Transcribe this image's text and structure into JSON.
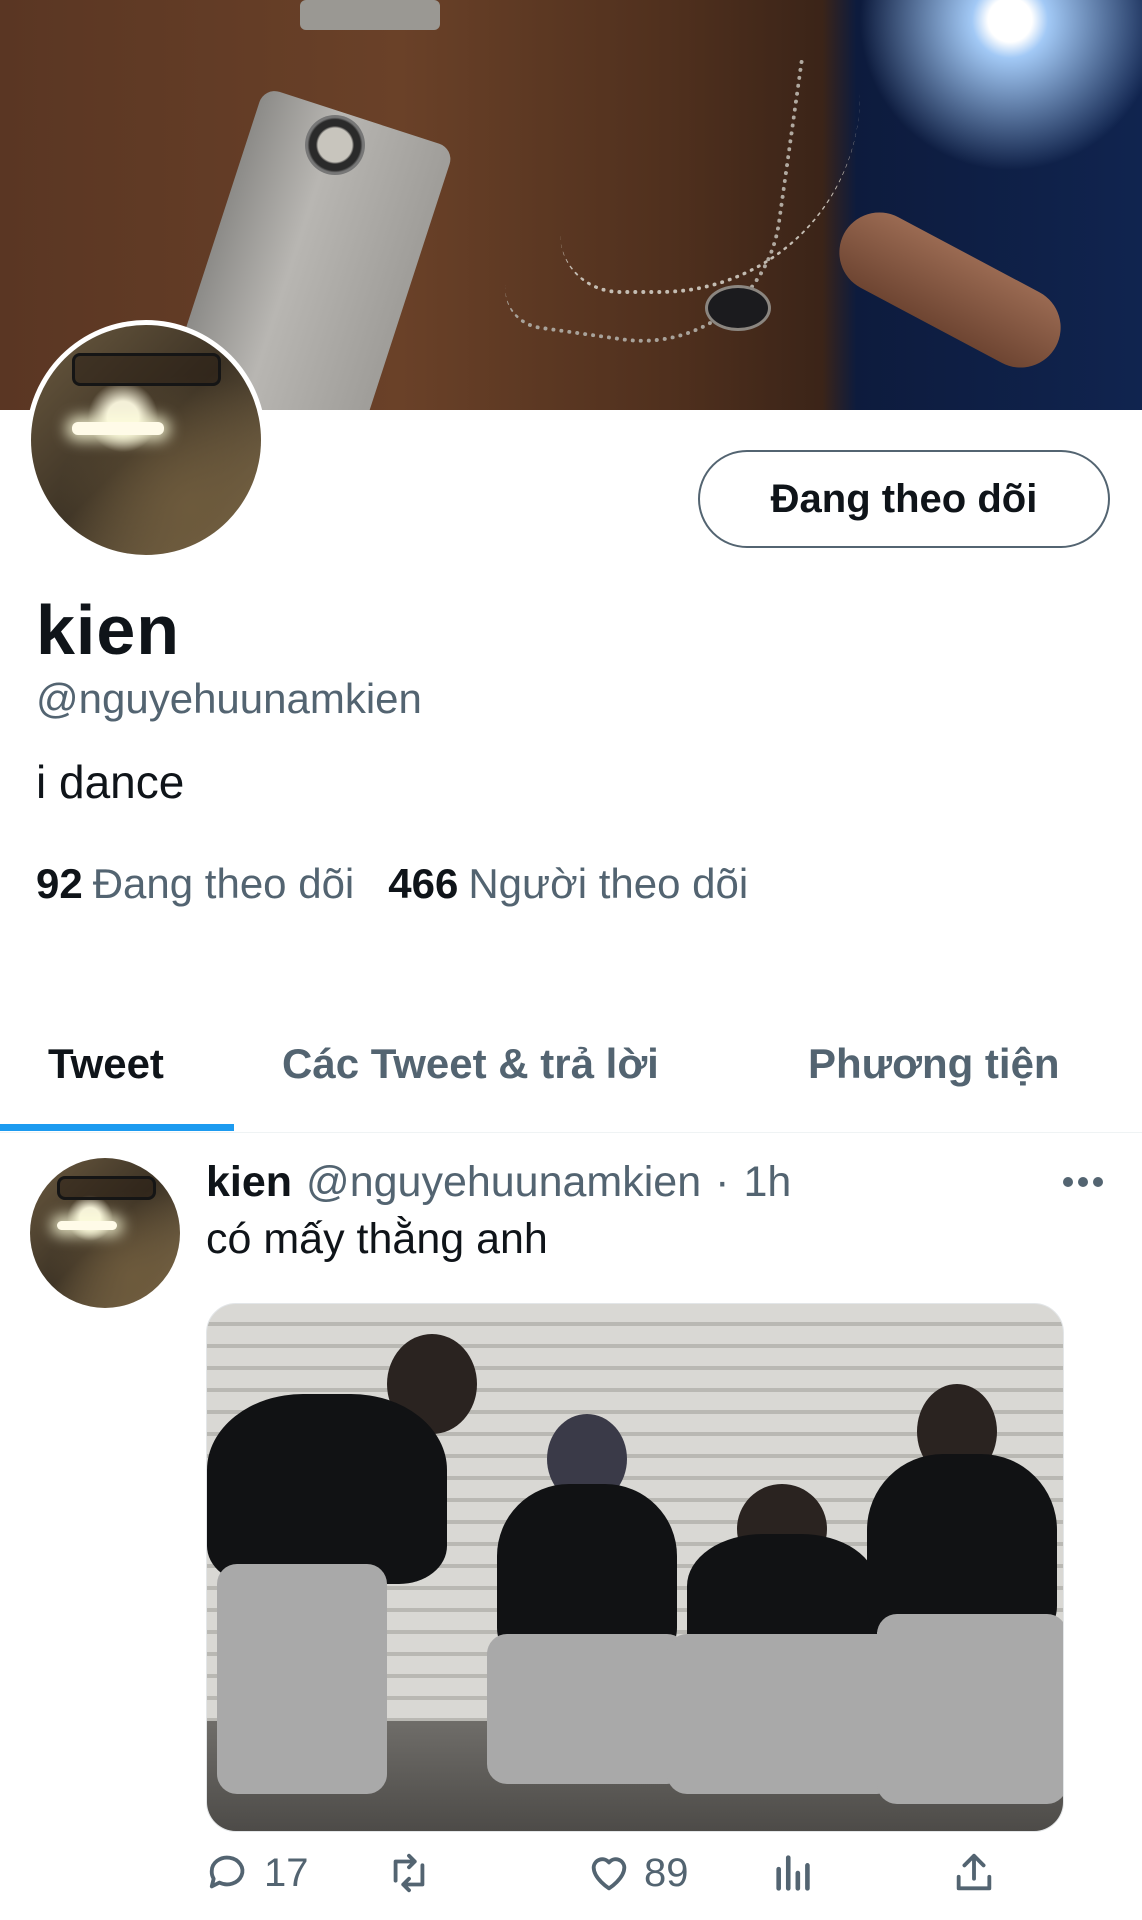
{
  "profile": {
    "display_name": "kien",
    "handle": "@nguyehuunamkien",
    "bio": "i dance",
    "follow_button": "Đang theo dõi",
    "following_count": "92",
    "following_label": "Đang theo dõi",
    "followers_count": "466",
    "followers_label": "Người theo dõi"
  },
  "tabs": [
    {
      "label": "Tweet",
      "active": true
    },
    {
      "label": "Các Tweet & trả lời",
      "active": false
    },
    {
      "label": "Phương tiện",
      "active": false
    }
  ],
  "tweet": {
    "name": "kien",
    "handle": "@nguyehuunamkien",
    "separator": "·",
    "time": "1h",
    "text": "có mấy thằng anh",
    "replies": "17",
    "likes": "89"
  },
  "colors": {
    "accent": "#1d9bf0",
    "secondary_text": "#536471",
    "primary_text": "#0f1419"
  },
  "icons": [
    "reply-icon",
    "retweet-icon",
    "like-icon",
    "views-icon",
    "share-icon",
    "more-icon"
  ]
}
